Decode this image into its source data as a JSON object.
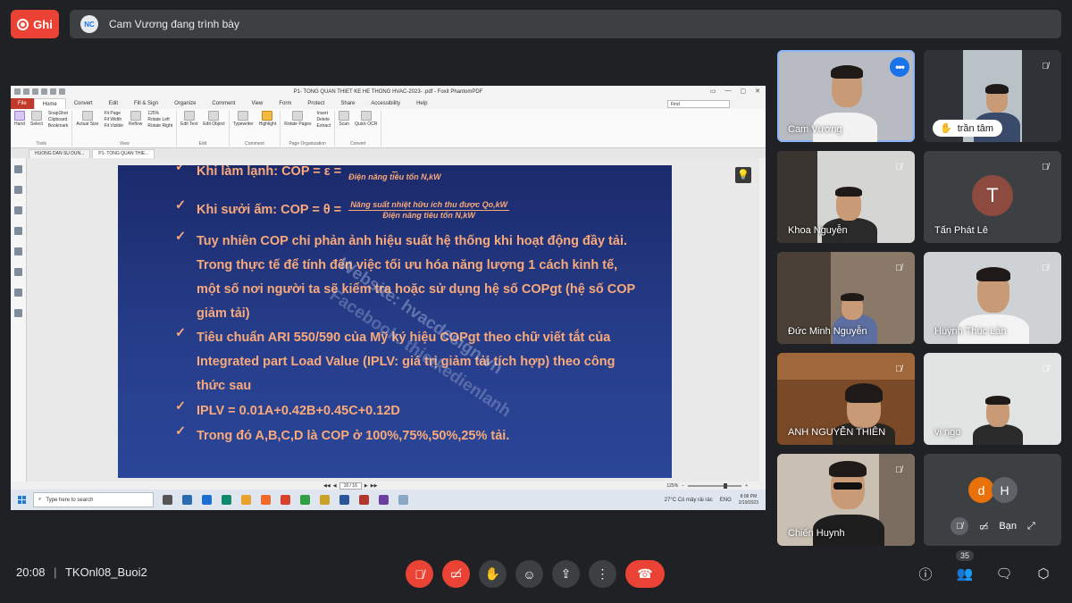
{
  "top_bar": {
    "record_label": "Ghi",
    "presenter_initials": "NC",
    "presenter_text": "Cam Vương đang trình bày"
  },
  "pdf": {
    "window_title": "P1- TONG QUAN THIET KE HE THONG HVAC-2023- .pdf - Foxit PhantomPDF",
    "menu_tabs": [
      "File",
      "Home",
      "Convert",
      "Edit",
      "Fill & Sign",
      "Organize",
      "Comment",
      "View",
      "Form",
      "Protect",
      "Share",
      "Accessibility",
      "Help"
    ],
    "find_placeholder": "Find",
    "ribbon": {
      "tools_group": "Tools",
      "hand": "Hand",
      "select": "Select",
      "snapshot": "SnapShot",
      "clipboard": "Clipboard",
      "bookmark": "Bookmark",
      "actual_size": "Actual Size",
      "fit_page": "Fit Page",
      "fit_width": "Fit Width",
      "fit_visible": "Fit Visible",
      "reflow": "Reflow",
      "zoom": "125%",
      "rotate_left": "Rotate Left",
      "rotate_right": "Rotate Right",
      "view_group": "View",
      "edit_text": "Edit Text",
      "edit_object": "Edit Object",
      "edit_group": "Edit",
      "typewriter": "Typewriter",
      "highlight": "Highlight",
      "comment_group": "Comment",
      "rotate_pages": "Rotate Pages",
      "insert": "Insert",
      "delete": "Delete",
      "extract": "Extract",
      "page_org_group": "Page Organization",
      "scan": "Scan",
      "quick_ocr": "Quick OCR",
      "convert_group": "Convert"
    },
    "doc_tabs": [
      "HUONG DAN SU DUN...",
      "P1- TONG QUAN THIE..."
    ],
    "page_indicator": "16 / 16",
    "zoom_status": "125%"
  },
  "slide": {
    "line1_label": "Khi làm lạnh: COP = ε =",
    "line1_den": "Điện năng tiêu tốn N,kW",
    "line2_label": "Khi sưởi ấm: COP = θ =",
    "line2_num": "Năng suất nhiệt hữu ích thu được Qo,kW",
    "line2_den": "Điện năng tiêu tốn N,kW",
    "line3": "Tuy nhiên COP chỉ phản ảnh hiệu suất hệ thống khi hoạt động đầy tải. Trong thực tế để tính đến việc tối ưu hóa năng lượng 1 cách kinh tế, một số nơi người ta sẽ kiểm tra hoặc sử dụng hệ số COPgt (hệ số COP giảm tải)",
    "line4": "Tiêu chuẩn ARI 550/590 của Mỹ ký hiệu COPgt theo chữ viết tắt của Integrated part Load Value (IPLV: giá trị giảm tải tích hợp) theo công thức sau",
    "line5": "IPLV = 0.01A+0.42B+0.45C+0.12D",
    "line6": "Trong đó A,B,C,D là COP ở 100%,75%,50%,25% tải.",
    "watermark1": "Website: hvacdesign.vn",
    "watermark2": "Facebook: thietkedienlanh"
  },
  "taskbar": {
    "search_placeholder": "Type here to search",
    "weather": "27°C  Có mây rải rác",
    "lang": "ENG",
    "time": "8:08 PM",
    "date": "2/19/2023"
  },
  "participants": [
    {
      "name": "Cam Vương"
    },
    {
      "name": "trần tâm"
    },
    {
      "name": "Khoa Nguyễn"
    },
    {
      "name": "Tấn Phát Lê",
      "initial": "T"
    },
    {
      "name": "Đức Minh Nguyễn"
    },
    {
      "name": "Huỳnh Thúc Lân"
    },
    {
      "name": "ANH NGUYỄN THIÊN"
    },
    {
      "name": "vi ngo"
    },
    {
      "name": "Chiến Huynh"
    }
  ],
  "self_tile": {
    "avatar1": "d",
    "avatar2": "H",
    "label": "Bạn"
  },
  "bottom": {
    "time": "20:08",
    "separator": "|",
    "meeting_code": "TKOnl08_Buoi2",
    "participant_count": "35"
  },
  "colors": {
    "record_red": "#ea4335",
    "accent_blue": "#8ab4f8",
    "slide_text": "#f9a97a"
  }
}
